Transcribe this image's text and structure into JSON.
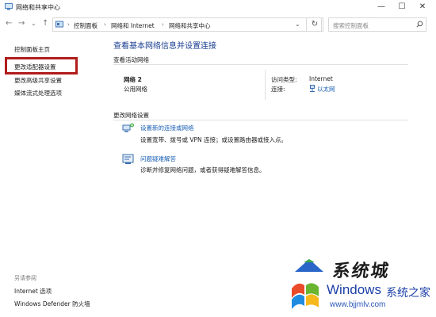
{
  "window": {
    "title": "网络和共享中心",
    "minimize_glyph": "—",
    "maximize_glyph": "☐",
    "close_glyph": "✕"
  },
  "nav": {
    "back": "←",
    "forward": "→",
    "dropdown": "⌄",
    "up": "↑",
    "breadcrumb": [
      "控制面板",
      "网络和 Internet",
      "网络和共享中心"
    ],
    "separator": "›",
    "refresh": "↻",
    "search_placeholder": "搜索控制面板"
  },
  "sidebar": {
    "items": [
      {
        "label": "控制面板主页"
      },
      {
        "label": "更改适配器设置"
      },
      {
        "label": "更改高级共享设置"
      },
      {
        "label": "媒体流式处理选项"
      }
    ],
    "see_also_title": "另请参阅",
    "see_also": [
      {
        "label": "Internet 选项"
      },
      {
        "label": "Windows Defender 防火墙"
      }
    ]
  },
  "main": {
    "heading": "查看基本网络信息并设置连接",
    "active_networks_label": "查看活动网络",
    "network": {
      "name": "网络 2",
      "type": "公用网络",
      "access_type_key": "访问类型:",
      "access_type_value": "Internet",
      "connection_key": "连接:",
      "connection_value": "以太网"
    },
    "change_settings_label": "更改网络设置",
    "tasks": [
      {
        "link": "设置新的连接或网络",
        "desc": "设置宽带、拨号或 VPN 连接；或设置路由器或接入点。"
      },
      {
        "link": "问题疑难解答",
        "desc": "诊断并修复网络问题，或者获得疑难解答信息。"
      }
    ]
  },
  "watermark": {
    "big": "系统城",
    "windows": "Windows",
    "cn": "系统之家",
    "url": "www.bjjmlv.com"
  }
}
